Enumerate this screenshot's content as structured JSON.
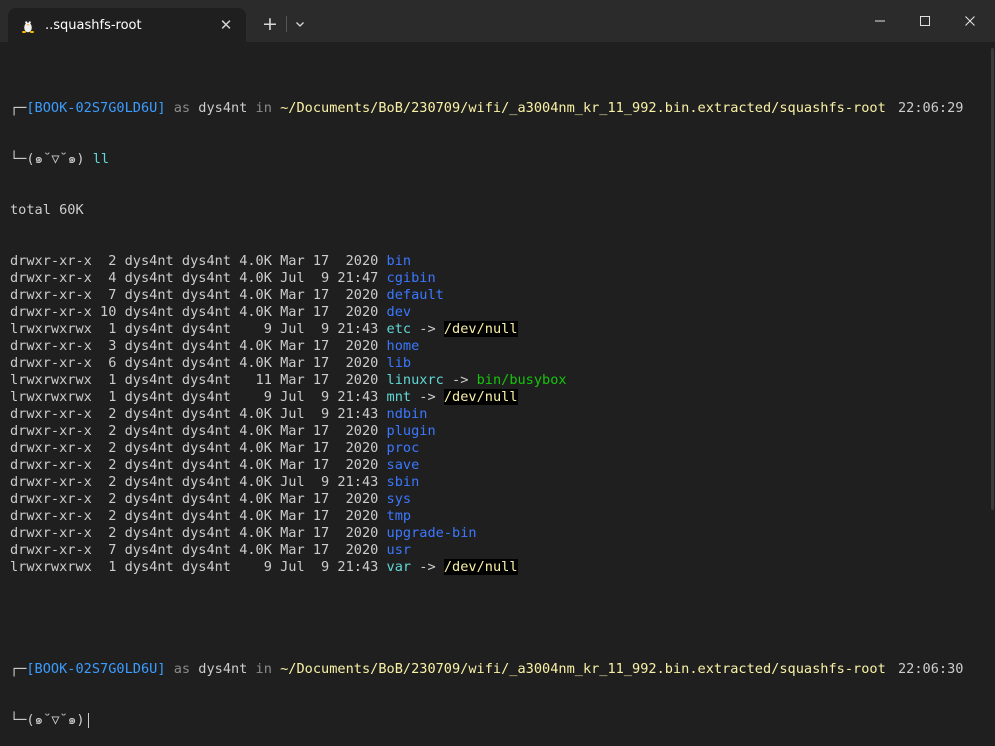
{
  "window": {
    "tab_title": "..squashfs-root",
    "tab_icon": "penguin-icon",
    "new_tab_label": "+",
    "close_label": "✕"
  },
  "colors": {
    "background": "#1f1f1f",
    "titlebar": "#2b2b2b",
    "prompt_user": "#3b9cff",
    "path": "#f9f1a5",
    "command": "#16c60c",
    "directory": "#3b78ff",
    "symlink": "#61d6d6"
  },
  "prompt1": {
    "corner_top": "┌─",
    "host": "[BOOK-02S7G0LD6U]",
    "as": " as ",
    "user": "dys4nt",
    "in": " in ",
    "path": "~/Documents/BoB/230709/wifi/_a3004nm_kr_11_992.bin.extracted/squashfs-root",
    "time": "22:06:29",
    "corner_bottom": "└─",
    "face": "(๑˘▽˘๑)",
    "command": "ll"
  },
  "total": "total 60K",
  "listing": [
    {
      "perm": "drwxr-xr-x",
      "links": " 2",
      "owner": "dys4nt",
      "group": "dys4nt",
      "size": "4.0K",
      "date": "Mar 17  2020",
      "name": "bin",
      "type": "dir",
      "target": ""
    },
    {
      "perm": "drwxr-xr-x",
      "links": " 4",
      "owner": "dys4nt",
      "group": "dys4nt",
      "size": "4.0K",
      "date": "Jul  9 21:47",
      "name": "cgibin",
      "type": "dir",
      "target": ""
    },
    {
      "perm": "drwxr-xr-x",
      "links": " 7",
      "owner": "dys4nt",
      "group": "dys4nt",
      "size": "4.0K",
      "date": "Mar 17  2020",
      "name": "default",
      "type": "dir",
      "target": ""
    },
    {
      "perm": "drwxr-xr-x",
      "links": "10",
      "owner": "dys4nt",
      "group": "dys4nt",
      "size": "4.0K",
      "date": "Mar 17  2020",
      "name": "dev",
      "type": "dir",
      "target": ""
    },
    {
      "perm": "lrwxrwxrwx",
      "links": " 1",
      "owner": "dys4nt",
      "group": "dys4nt",
      "size": "   9",
      "date": "Jul  9 21:43",
      "name": "etc",
      "type": "link",
      "target": "/dev/null"
    },
    {
      "perm": "drwxr-xr-x",
      "links": " 3",
      "owner": "dys4nt",
      "group": "dys4nt",
      "size": "4.0K",
      "date": "Mar 17  2020",
      "name": "home",
      "type": "dir",
      "target": ""
    },
    {
      "perm": "drwxr-xr-x",
      "links": " 6",
      "owner": "dys4nt",
      "group": "dys4nt",
      "size": "4.0K",
      "date": "Mar 17  2020",
      "name": "lib",
      "type": "dir",
      "target": ""
    },
    {
      "perm": "lrwxrwxrwx",
      "links": " 1",
      "owner": "dys4nt",
      "group": "dys4nt",
      "size": "  11",
      "date": "Mar 17  2020",
      "name": "linuxrc",
      "type": "link-ok",
      "target": "bin/busybox"
    },
    {
      "perm": "lrwxrwxrwx",
      "links": " 1",
      "owner": "dys4nt",
      "group": "dys4nt",
      "size": "   9",
      "date": "Jul  9 21:43",
      "name": "mnt",
      "type": "link",
      "target": "/dev/null"
    },
    {
      "perm": "drwxr-xr-x",
      "links": " 2",
      "owner": "dys4nt",
      "group": "dys4nt",
      "size": "4.0K",
      "date": "Jul  9 21:43",
      "name": "ndbin",
      "type": "dir",
      "target": ""
    },
    {
      "perm": "drwxr-xr-x",
      "links": " 2",
      "owner": "dys4nt",
      "group": "dys4nt",
      "size": "4.0K",
      "date": "Mar 17  2020",
      "name": "plugin",
      "type": "dir",
      "target": ""
    },
    {
      "perm": "drwxr-xr-x",
      "links": " 2",
      "owner": "dys4nt",
      "group": "dys4nt",
      "size": "4.0K",
      "date": "Mar 17  2020",
      "name": "proc",
      "type": "dir",
      "target": ""
    },
    {
      "perm": "drwxr-xr-x",
      "links": " 2",
      "owner": "dys4nt",
      "group": "dys4nt",
      "size": "4.0K",
      "date": "Mar 17  2020",
      "name": "save",
      "type": "dir",
      "target": ""
    },
    {
      "perm": "drwxr-xr-x",
      "links": " 2",
      "owner": "dys4nt",
      "group": "dys4nt",
      "size": "4.0K",
      "date": "Jul  9 21:43",
      "name": "sbin",
      "type": "dir",
      "target": ""
    },
    {
      "perm": "drwxr-xr-x",
      "links": " 2",
      "owner": "dys4nt",
      "group": "dys4nt",
      "size": "4.0K",
      "date": "Mar 17  2020",
      "name": "sys",
      "type": "dir",
      "target": ""
    },
    {
      "perm": "drwxr-xr-x",
      "links": " 2",
      "owner": "dys4nt",
      "group": "dys4nt",
      "size": "4.0K",
      "date": "Mar 17  2020",
      "name": "tmp",
      "type": "dir",
      "target": ""
    },
    {
      "perm": "drwxr-xr-x",
      "links": " 2",
      "owner": "dys4nt",
      "group": "dys4nt",
      "size": "4.0K",
      "date": "Mar 17  2020",
      "name": "upgrade-bin",
      "type": "dir",
      "target": ""
    },
    {
      "perm": "drwxr-xr-x",
      "links": " 7",
      "owner": "dys4nt",
      "group": "dys4nt",
      "size": "4.0K",
      "date": "Mar 17  2020",
      "name": "usr",
      "type": "dir",
      "target": ""
    },
    {
      "perm": "lrwxrwxrwx",
      "links": " 1",
      "owner": "dys4nt",
      "group": "dys4nt",
      "size": "   9",
      "date": "Jul  9 21:43",
      "name": "var",
      "type": "link",
      "target": "/dev/null"
    }
  ],
  "prompt2": {
    "corner_top": "┌─",
    "host": "[BOOK-02S7G0LD6U]",
    "as": " as ",
    "user": "dys4nt",
    "in": " in ",
    "path": "~/Documents/BoB/230709/wifi/_a3004nm_kr_11_992.bin.extracted/squashfs-root",
    "time": "22:06:30",
    "corner_bottom": "└─",
    "face": "(๑˘▽˘๑)"
  }
}
